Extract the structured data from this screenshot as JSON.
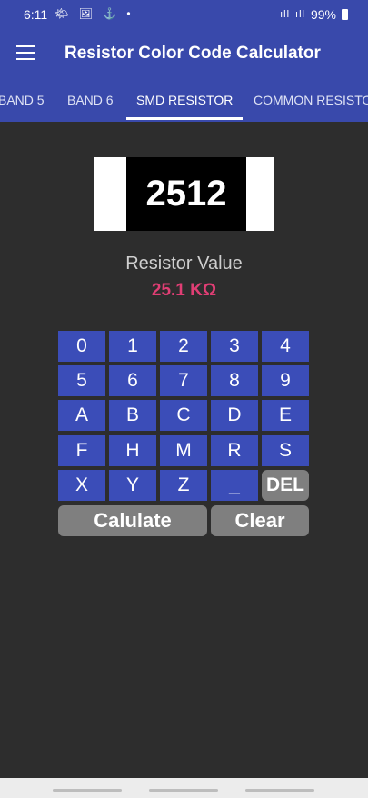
{
  "status": {
    "time": "6:11",
    "left_icons": "🌤 🖼 ⚓ •",
    "signal_1": "ıll",
    "signal_2": "ıll",
    "battery": "99%"
  },
  "app_bar": {
    "title": "Resistor Color Code Calculator",
    "menu_icon": "hamburger-icon"
  },
  "tabs": [
    "BAND 5",
    "BAND 6",
    "SMD RESISTOR",
    "COMMON RESISTO"
  ],
  "active_tab": 2,
  "resistor": {
    "code": "2512",
    "label": "Resistor Value",
    "value": "25.1 KΩ"
  },
  "keypad": {
    "rows": [
      [
        "0",
        "1",
        "2",
        "3",
        "4"
      ],
      [
        "5",
        "6",
        "7",
        "8",
        "9"
      ],
      [
        "A",
        "B",
        "C",
        "D",
        "E"
      ],
      [
        "F",
        "H",
        "M",
        "R",
        "S"
      ],
      [
        "X",
        "Y",
        "Z",
        "_",
        "DEL"
      ]
    ]
  },
  "actions": {
    "calculate": "Calulate",
    "clear": "Clear"
  },
  "colors": {
    "primary": "#3949ab",
    "key": "#3b4db8",
    "value": "#e03e74",
    "background": "#2d2d2d",
    "secondary": "#7f7f7f"
  }
}
